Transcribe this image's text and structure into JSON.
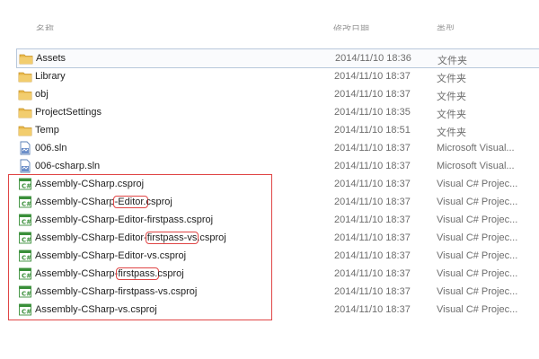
{
  "header": {
    "name_col": "名称",
    "date_col": "修改日期",
    "type_col": "类型"
  },
  "files": [
    {
      "name": "Assets",
      "date": "2014/11/10 18:36",
      "type": "文件夹",
      "icon": "folder-icon"
    },
    {
      "name": "Library",
      "date": "2014/11/10 18:37",
      "type": "文件夹",
      "icon": "folder-icon"
    },
    {
      "name": "obj",
      "date": "2014/11/10 18:37",
      "type": "文件夹",
      "icon": "folder-icon"
    },
    {
      "name": "ProjectSettings",
      "date": "2014/11/10 18:35",
      "type": "文件夹",
      "icon": "folder-icon"
    },
    {
      "name": "Temp",
      "date": "2014/11/10 18:51",
      "type": "文件夹",
      "icon": "folder-icon"
    },
    {
      "name": "006.sln",
      "date": "2014/11/10 18:37",
      "type": "Microsoft Visual...",
      "icon": "visual-studio-solution-icon"
    },
    {
      "name": "006-csharp.sln",
      "date": "2014/11/10 18:37",
      "type": "Microsoft Visual...",
      "icon": "visual-studio-solution-icon"
    },
    {
      "name": "Assembly-CSharp.csproj",
      "date": "2014/11/10 18:37",
      "type": "Visual C# Projec...",
      "icon": "csharp-project-icon"
    },
    {
      "name": "Assembly-CSharp-Editor.csproj",
      "date": "2014/11/10 18:37",
      "type": "Visual C# Projec...",
      "icon": "csharp-project-icon"
    },
    {
      "name": "Assembly-CSharp-Editor-firstpass.csproj",
      "date": "2014/11/10 18:37",
      "type": "Visual C# Projec...",
      "icon": "csharp-project-icon"
    },
    {
      "name": "Assembly-CSharp-Editor-firstpass-vs.csproj",
      "date": "2014/11/10 18:37",
      "type": "Visual C# Projec...",
      "icon": "csharp-project-icon"
    },
    {
      "name": "Assembly-CSharp-Editor-vs.csproj",
      "date": "2014/11/10 18:37",
      "type": "Visual C# Projec...",
      "icon": "csharp-project-icon"
    },
    {
      "name": "Assembly-CSharp-firstpass.csproj",
      "date": "2014/11/10 18:37",
      "type": "Visual C# Projec...",
      "icon": "csharp-project-icon"
    },
    {
      "name": "Assembly-CSharp-firstpass-vs.csproj",
      "date": "2014/11/10 18:37",
      "type": "Visual C# Projec...",
      "icon": "csharp-project-icon"
    },
    {
      "name": "Assembly-CSharp-vs.csproj",
      "date": "2014/11/10 18:37",
      "type": "Visual C# Projec...",
      "icon": "csharp-project-icon"
    }
  ],
  "name_parts": {
    "r8a": "Assembly-CSharp",
    "r8b": "-Editor.",
    "r8c": "csproj",
    "r10a": "Assembly-CSharp-Editor-",
    "r10b": "firstpass-vs",
    "r10c": ".csproj",
    "r12a": "Assembly-CSharp-",
    "r12b": "firstpass.",
    "r12c": "csproj"
  },
  "colors": {
    "highlight_border": "#e04545",
    "folder": "#e8b84a",
    "csharp_icon": "#3a8f3a"
  }
}
